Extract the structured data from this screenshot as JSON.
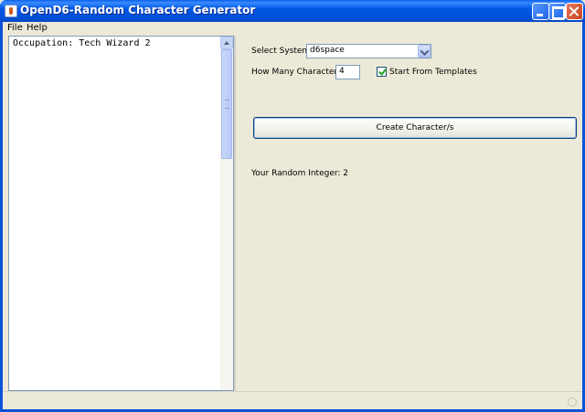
{
  "window": {
    "title": "OpenD6-Random Character Generator"
  },
  "menu": {
    "items": [
      {
        "label": "File"
      },
      {
        "label": "Help"
      }
    ]
  },
  "output": {
    "text": "Occupation: Tech Wizard 2"
  },
  "form": {
    "system_label": "Select System:",
    "system_value": "d6space",
    "count_label": "How Many Characters?:",
    "count_value": "4",
    "templates_label": "Start From Templates",
    "templates_checked": true,
    "create_label": "Create Character/s",
    "random_integer_text": "Your Random Integer: 2"
  },
  "icons": {
    "app": "java-app-icon",
    "minimize": "minimize-icon",
    "maximize": "maximize-icon",
    "close": "close-icon",
    "dropdown": "chevron-down-icon"
  }
}
